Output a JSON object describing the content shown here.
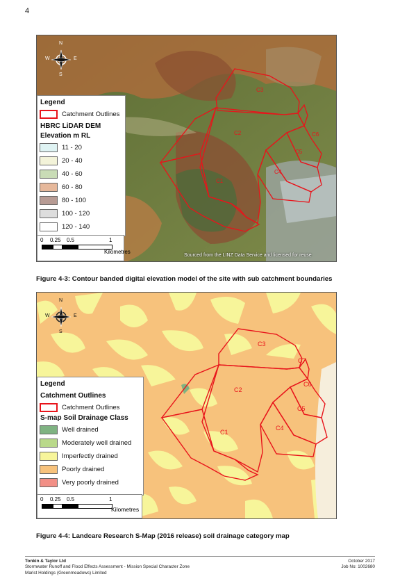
{
  "page_number": "4",
  "figure1": {
    "caption": "Figure 4-3: Contour banded digital elevation model of the site with sub catchment boundaries",
    "attribution": "Sourced from the LINZ Data Service and licensed for reuse",
    "legend": {
      "title": "Legend",
      "outline_label": "Catchment Outlines",
      "dem_title": "HBRC LiDAR DEM",
      "elev_title": "Elevation m RL",
      "classes": [
        {
          "label": "11 - 20",
          "color": "#dff3f3"
        },
        {
          "label": "20 - 40",
          "color": "#f3f3d9"
        },
        {
          "label": "40 - 60",
          "color": "#c9dcb6"
        },
        {
          "label": "60 - 80",
          "color": "#e6b89b"
        },
        {
          "label": "80 - 100",
          "color": "#b79b94"
        },
        {
          "label": "100 - 120",
          "color": "#dddddd"
        },
        {
          "label": "120 - 140",
          "color": "#ffffff"
        }
      ]
    },
    "catchments": [
      "C3",
      "C2",
      "C6",
      "C5",
      "C4",
      "C1"
    ],
    "scale": {
      "ticks": [
        "0",
        "0.25",
        "0.5",
        "1"
      ],
      "unit": "Kilometres"
    },
    "compass": {
      "n": "N",
      "s": "S",
      "e": "E",
      "w": "W"
    }
  },
  "figure2": {
    "caption": "Figure 4-4: Landcare Research S-Map (2016 release) soil drainage category map",
    "legend": {
      "title": "Legend",
      "outline_title": "Catchment Outlines",
      "outline_label": "Catchment Outlines",
      "class_title": "S-map Soil Drainage Class",
      "classes": [
        {
          "label": "Well drained",
          "color": "#7fb382"
        },
        {
          "label": "Moderately well drained",
          "color": "#b9d98a"
        },
        {
          "label": "Imperfectly drained",
          "color": "#f7f59a"
        },
        {
          "label": "Poorly drained",
          "color": "#f7c27c"
        },
        {
          "label": "Very poorly drained",
          "color": "#f28f86"
        }
      ]
    },
    "catchments": [
      "C3",
      "C7",
      "C6",
      "C2",
      "C5",
      "C4",
      "C1"
    ],
    "scale": {
      "ticks": [
        "0",
        "0.25",
        "0.5",
        "1"
      ],
      "unit": "Kilometres"
    },
    "compass": {
      "n": "N",
      "s": "S",
      "e": "E",
      "w": "W"
    }
  },
  "footer": {
    "company": "Tonkin & Taylor Ltd",
    "report": "Stormwater Runoff and Flood Effects Assessment - Mission Special Character Zone",
    "client": "Marist Holdings (Greenmeadows) Limited",
    "date": "October 2017",
    "job": "Job No: 1002680"
  }
}
